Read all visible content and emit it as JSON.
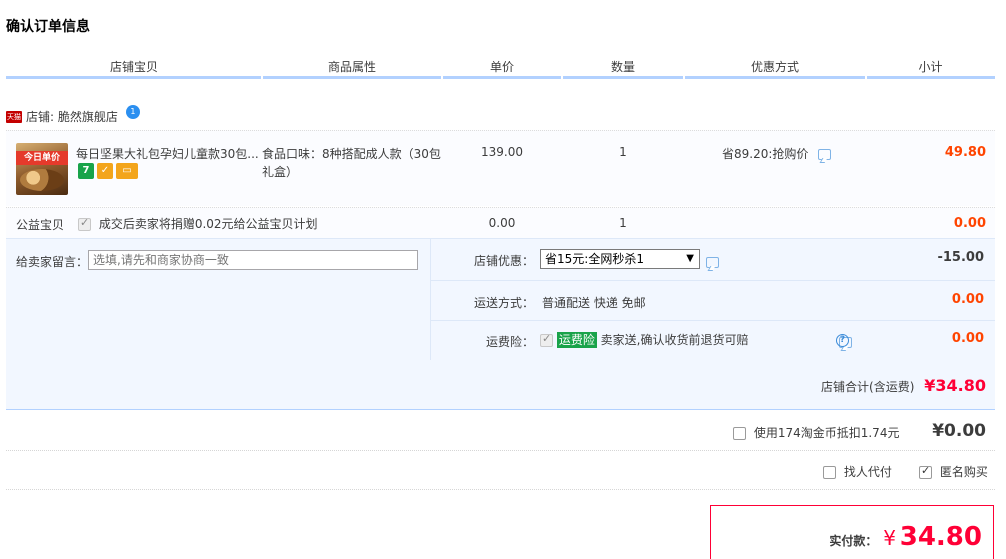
{
  "page_title": "确认订单信息",
  "columns": [
    "店铺宝贝",
    "商品属性",
    "单价",
    "数量",
    "优惠方式",
    "小计"
  ],
  "shop": {
    "badge": "天猫",
    "label": "店铺: 脆然旗舰店",
    "badge_count": "1"
  },
  "item": {
    "thumb_banner": "今日单价",
    "title": "每日坚果大礼包孕妇儿童款30包...",
    "service_icons": [
      "7",
      "✓",
      "▭"
    ],
    "attr": "食品口味：8种搭配成人款（30包礼盒）",
    "price": "139.00",
    "qty": "1",
    "discount": "省89.20:抢购价",
    "subtotal": "49.80"
  },
  "charity": {
    "label": "公益宝贝",
    "text": "成交后卖家将捐赠0.02元给公益宝贝计划",
    "price": "0.00",
    "qty": "1",
    "subtotal": "0.00"
  },
  "message": {
    "label": "给卖家留言：",
    "placeholder": "选填,请先和商家协商一致"
  },
  "shop_discount": {
    "label": "店铺优惠：",
    "selected": "省15元:全网秒杀1",
    "amount": "-15.00"
  },
  "shipping": {
    "label": "运送方式：",
    "value": "普通配送 快递 免邮",
    "amount": "0.00"
  },
  "insurance": {
    "label": "运费险：",
    "tag": "运费险",
    "text": "卖家送,确认收货前退货可赔",
    "amount": "0.00"
  },
  "shop_total": {
    "label": "店铺合计(含运费)",
    "value": "¥34.80"
  },
  "coins": {
    "text": "使用174淘金币抵扣1.74元",
    "value": "¥0.00"
  },
  "options": {
    "proxy": "找人代付",
    "anonymous": "匿名购买"
  },
  "payment": {
    "label": "实付款：",
    "currency": "¥",
    "value": "34.80"
  },
  "colors": {
    "accent_red": "#ff0036",
    "header_blue": "#b2d1ff",
    "insurance_green": "#19a34a"
  }
}
